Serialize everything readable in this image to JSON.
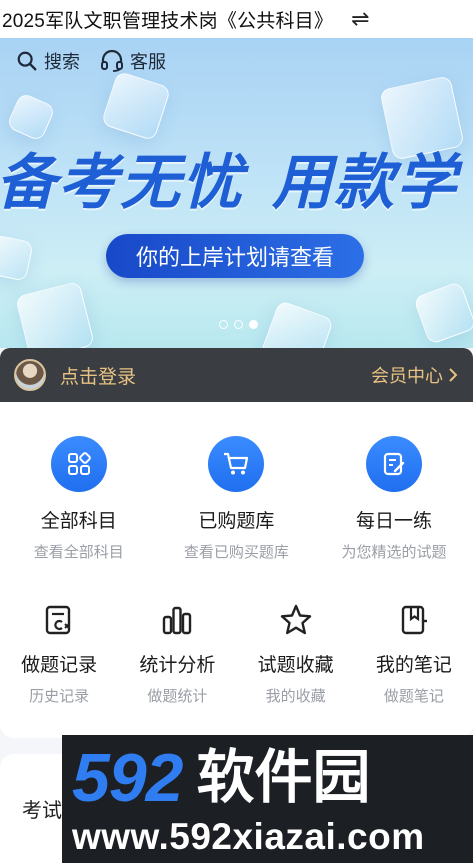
{
  "header": {
    "title": "2025军队文职管理技术岗《公共科目》",
    "switch_icon": "⇌"
  },
  "banner": {
    "search_label": "搜索",
    "service_label": "客服",
    "headline_a": "备考无忧",
    "headline_b": "用款学",
    "pill_text": "你的上岸计划请查看",
    "slide_count": 3,
    "active_slide": 3
  },
  "login": {
    "login_text": "点击登录",
    "member_text": "会员中心",
    "accent": "#e8c382"
  },
  "features": [
    {
      "label": "全部科目",
      "sub": "查看全部科目"
    },
    {
      "label": "已购题库",
      "sub": "查看已购买题库"
    },
    {
      "label": "每日一练",
      "sub": "为您精选的试题"
    }
  ],
  "tools": [
    {
      "label": "做题记录",
      "sub": "历史记录"
    },
    {
      "label": "统计分析",
      "sub": "做题统计"
    },
    {
      "label": "试题收藏",
      "sub": "我的收藏"
    },
    {
      "label": "我的笔记",
      "sub": "做题笔记"
    }
  ],
  "bottom": {
    "title": "考试"
  },
  "watermark": {
    "num": "592",
    "cn": "软件园",
    "url": "www.592xiazai.com"
  },
  "colors": {
    "brand_blue": "#1f6ff0",
    "login_bar": "#3a3d42"
  }
}
